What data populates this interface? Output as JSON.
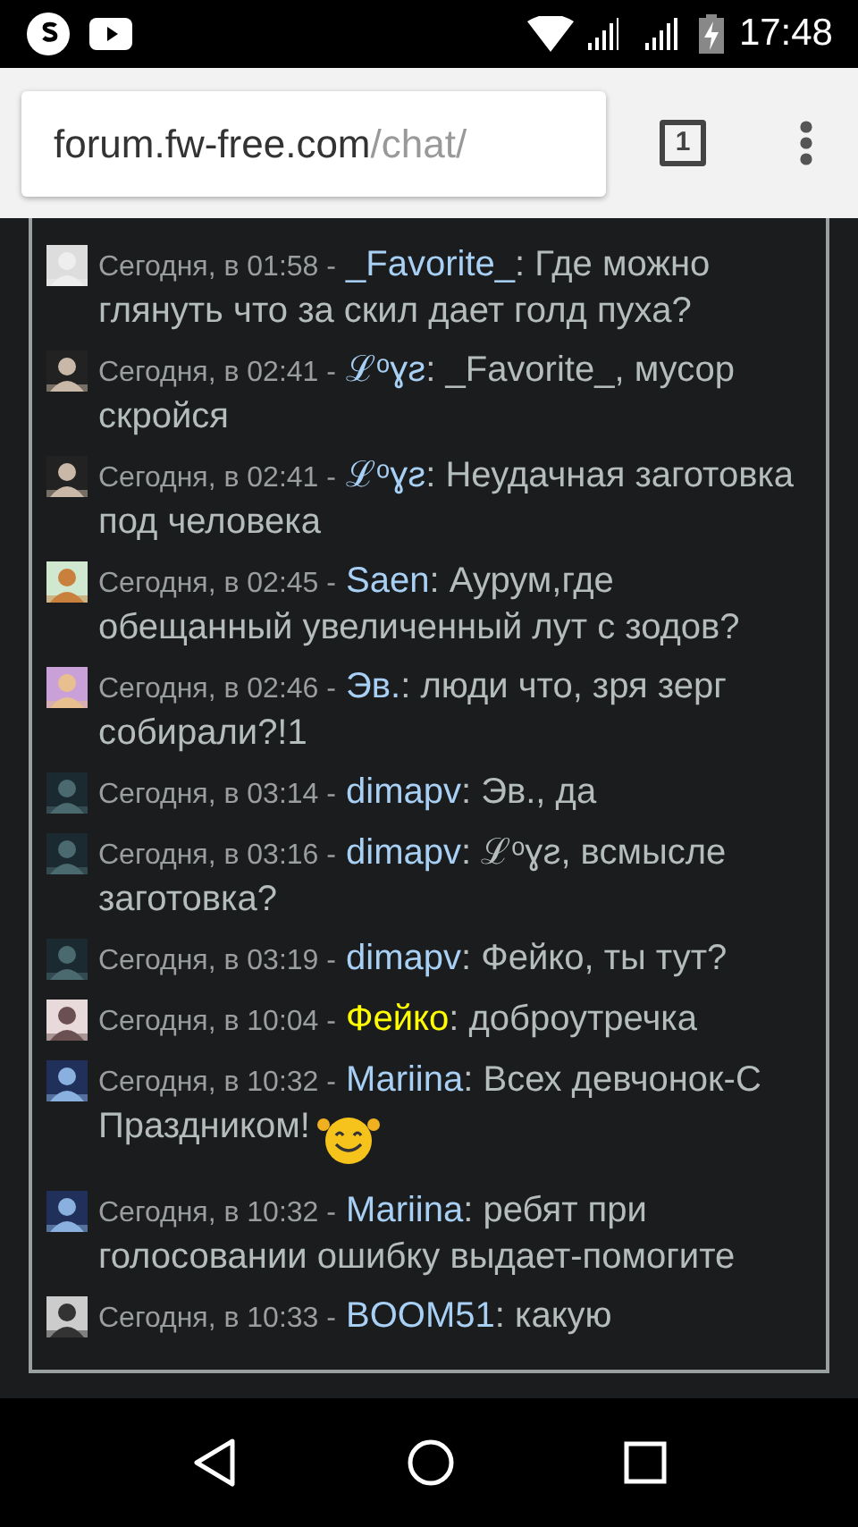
{
  "status_bar": {
    "time": "17:48"
  },
  "browser": {
    "url_host": "forum.fw-free.com",
    "url_path": "/chat/",
    "tab_count": "1"
  },
  "messages": [
    {
      "time": "Сегодня, в 01:58 -",
      "user": "_Favorite_",
      "color": "#a8d0f5",
      "text": ": Где можно глянуть что за скил дает голд пуха?"
    },
    {
      "time": "Сегодня, в 02:41 -",
      "user": "ℒᵒɣƨ",
      "color": "#a8d0f5",
      "text": ": _Favorite_, мусор скройся"
    },
    {
      "time": "Сегодня, в 02:41 -",
      "user": "ℒᵒɣƨ",
      "color": "#a8d0f5",
      "text": ": Неудачная заготовка под человека"
    },
    {
      "time": "Сегодня, в 02:45 -",
      "user": "Saen",
      "color": "#a8d0f5",
      "text": ": Аурум,где обещанный увеличенный лут с зодов?"
    },
    {
      "time": "Сегодня, в 02:46 -",
      "user": "Эв.",
      "color": "#a8d0f5",
      "text": ": люди что, зря зерг собирали?!1"
    },
    {
      "time": "Сегодня, в 03:14 -",
      "user": "dimapv",
      "color": "#a8d0f5",
      "text": ": Эв., да"
    },
    {
      "time": "Сегодня, в 03:16 -",
      "user": "dimapv",
      "color": "#a8d0f5",
      "text": ": ℒᵒɣƨ, всмысле заготовка?"
    },
    {
      "time": "Сегодня, в 03:19 -",
      "user": "dimapv",
      "color": "#a8d0f5",
      "text": ": Фейко, ты тут?"
    },
    {
      "time": "Сегодня, в 10:04 -",
      "user": "Фейко",
      "color": "#ffff00",
      "text": ": доброутречка"
    },
    {
      "time": "Сегодня, в 10:32 -",
      "user": "Mariina",
      "color": "#a8d0f5",
      "text": ": Всех девчонок-С Праздником!",
      "smiley": true
    },
    {
      "time": "Сегодня, в 10:32 -",
      "user": "Mariina",
      "color": "#a8d0f5",
      "text": ": ребят при голосовании ошибку выдает-помогите"
    },
    {
      "time": "Сегодня, в 10:33 -",
      "user": "BOOM51",
      "color": "#a8d0f5",
      "text": ": какую"
    }
  ]
}
